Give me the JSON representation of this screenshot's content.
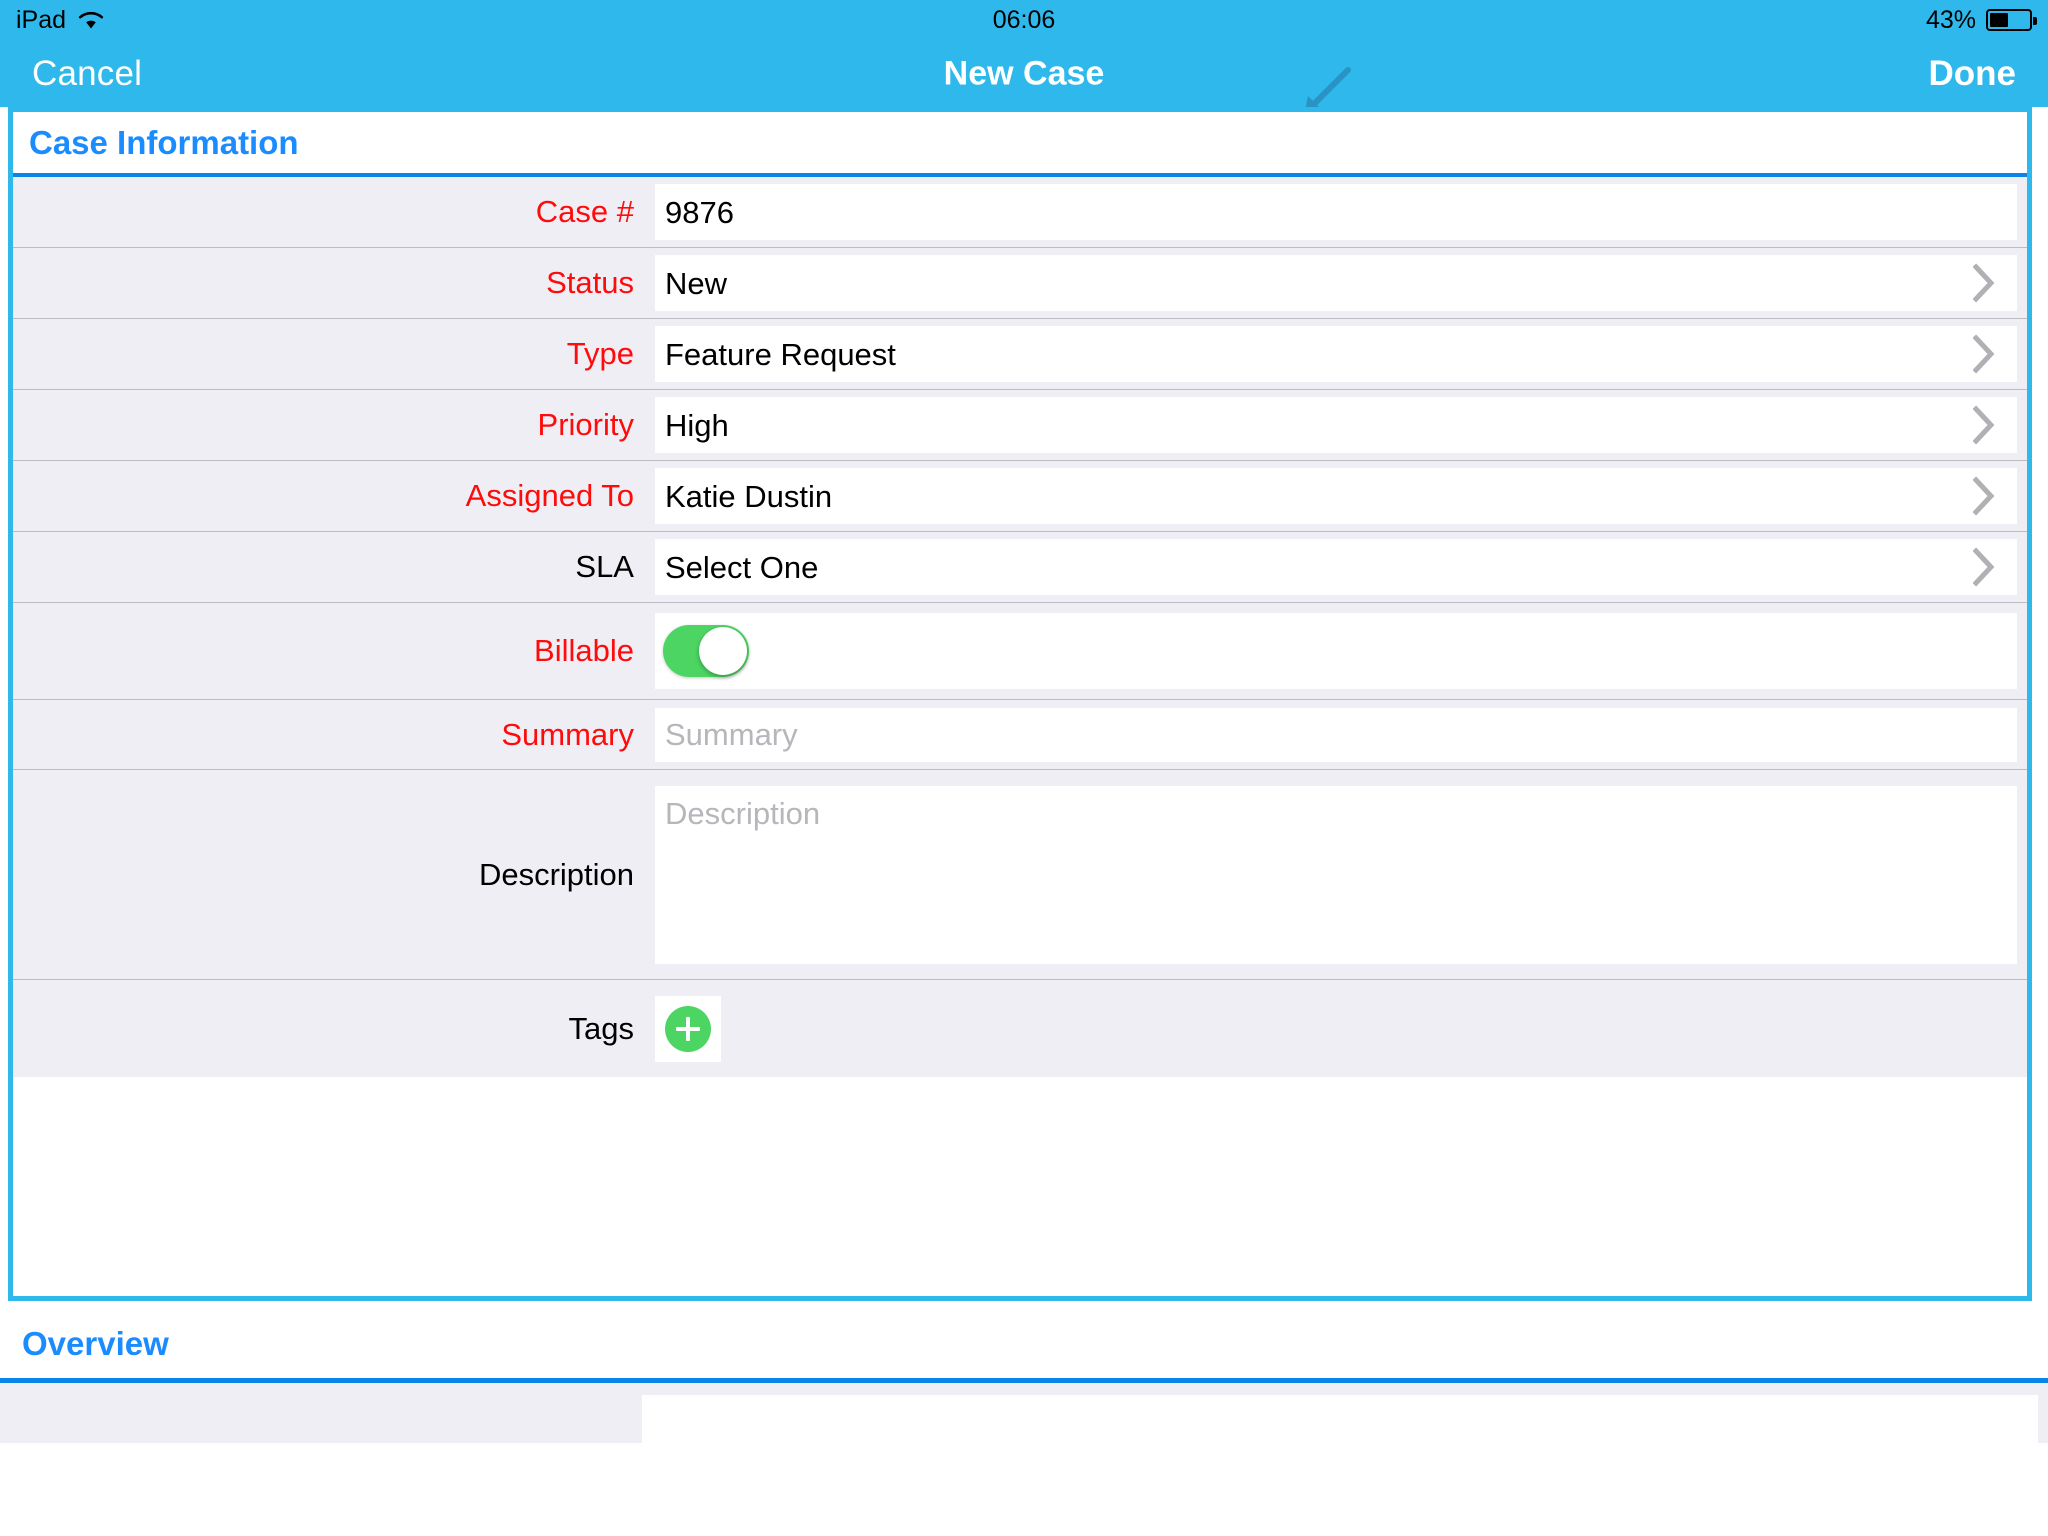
{
  "status_bar": {
    "device": "iPad",
    "wifi_icon": "wifi-icon",
    "time": "06:06",
    "battery_percent": "43%",
    "battery_icon": "battery-icon",
    "battery_level": 43
  },
  "nav_bar": {
    "cancel_label": "Cancel",
    "title": "New Case",
    "done_label": "Done",
    "background_color": "#2FB8EB"
  },
  "cursor": {
    "icon": "mouse-pointer-arrow-icon"
  },
  "sections": [
    {
      "title": "Case Information",
      "highlighted": true,
      "rows": [
        {
          "label": "Case #",
          "required": true,
          "value": "9876",
          "type": "text",
          "chevron": false
        },
        {
          "label": "Status",
          "required": true,
          "value": "New",
          "type": "picker",
          "chevron": true
        },
        {
          "label": "Type",
          "required": true,
          "value": "Feature Request",
          "type": "picker",
          "chevron": true
        },
        {
          "label": "Priority",
          "required": true,
          "value": "High",
          "type": "picker",
          "chevron": true
        },
        {
          "label": "Assigned To",
          "required": true,
          "value": "Katie Dustin",
          "type": "picker",
          "chevron": true
        },
        {
          "label": "SLA",
          "required": false,
          "value": "Select One",
          "type": "picker",
          "chevron": true
        },
        {
          "label": "Billable",
          "required": true,
          "value": "",
          "type": "toggle",
          "toggle_on": true,
          "chevron": false
        },
        {
          "label": "Summary",
          "required": true,
          "value": "",
          "placeholder": "Summary",
          "type": "text",
          "chevron": false
        },
        {
          "label": "Description",
          "required": false,
          "value": "",
          "placeholder": "Description",
          "type": "textarea",
          "chevron": false
        },
        {
          "label": "Tags",
          "required": false,
          "value": "",
          "type": "add",
          "add_icon": "plus-circle-icon",
          "chevron": false
        }
      ]
    },
    {
      "title": "Overview",
      "highlighted": false,
      "rows": []
    }
  ],
  "colors": {
    "accent_blue": "#2FB8EB",
    "section_title_blue": "#1A8CFF",
    "required_red": "#FF0B0B",
    "row_background": "#EFEEF4",
    "toggle_green": "#4CD563",
    "placeholder_gray": "#B6B6BB"
  }
}
